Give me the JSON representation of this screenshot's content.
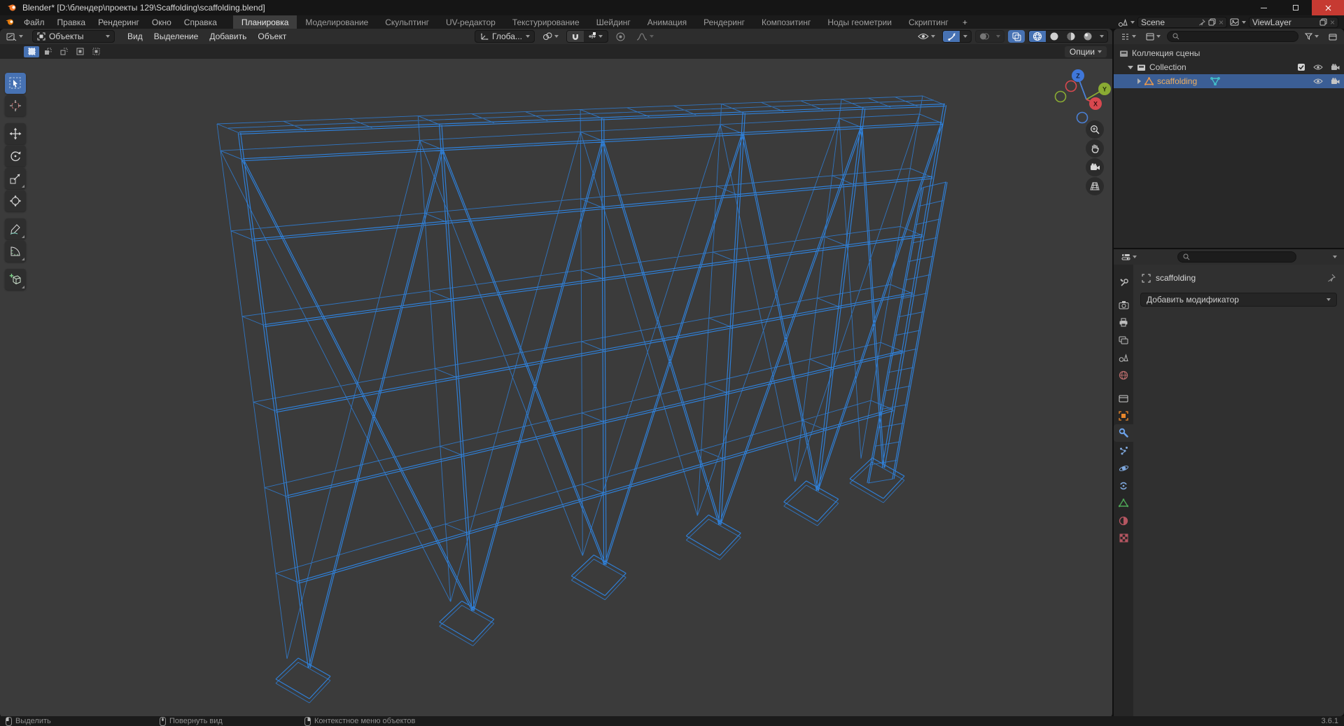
{
  "window": {
    "title": "Blender* [D:\\блендер\\проекты 129\\Scaffolding\\scaffolding.blend]"
  },
  "topbar": {
    "menus": [
      "Файл",
      "Правка",
      "Рендеринг",
      "Окно",
      "Справка"
    ],
    "tabs": [
      "Планировка",
      "Моделирование",
      "Скульптинг",
      "UV-редактор",
      "Текстурирование",
      "Шейдинг",
      "Анимация",
      "Рендеринг",
      "Композитинг",
      "Ноды геометрии",
      "Скриптинг"
    ],
    "active_tab": "Планировка",
    "new_tab_label": "+",
    "scene_name": "Scene",
    "view_layer_name": "ViewLayer"
  },
  "viewport": {
    "mode_label": "Объекты",
    "menus": [
      "Вид",
      "Выделение",
      "Добавить",
      "Объект"
    ],
    "orientation_label": "Глоба...",
    "options_label": "Опции"
  },
  "outliner": {
    "scene_collection_label": "Коллекция сцены",
    "collection_label": "Collection",
    "object_label": "scaffolding"
  },
  "properties": {
    "object_name": "scaffolding",
    "add_modifier_label": "Добавить модификатор"
  },
  "statusbar": {
    "hints": [
      "Выделить",
      "Повернуть вид",
      "Контекстное меню объектов"
    ],
    "version": "3.6.1"
  },
  "colors": {
    "wire": "#2f80d9",
    "accent": "#4772b3",
    "selection": "#3b5e95",
    "object_name_text": "#efae5e",
    "viewport_bg": "#3b3b3b"
  }
}
